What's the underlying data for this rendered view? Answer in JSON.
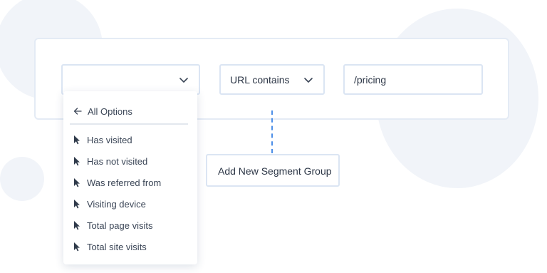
{
  "filter_row": {
    "first_select": {
      "value": "",
      "icon": "chevron-down-icon"
    },
    "condition_select": {
      "value": "URL contains",
      "icon": "chevron-down-icon"
    },
    "value_input": {
      "value": "/pricing"
    }
  },
  "add_group_button": {
    "label": "Add New Segment Group"
  },
  "dropdown": {
    "back_icon": "arrow-left-icon",
    "back_label": "All Options",
    "item_icon": "cursor-arrow-icon",
    "items": [
      {
        "label": "Has visited"
      },
      {
        "label": "Has not visited"
      },
      {
        "label": "Was referred from"
      },
      {
        "label": "Visiting device"
      },
      {
        "label": "Total page visits"
      },
      {
        "label": "Total site visits"
      }
    ]
  },
  "colors": {
    "connector": "#4d8fe8",
    "border": "#dbe5f3",
    "text": "#2c3646",
    "background_blob": "#f1f4f9"
  }
}
